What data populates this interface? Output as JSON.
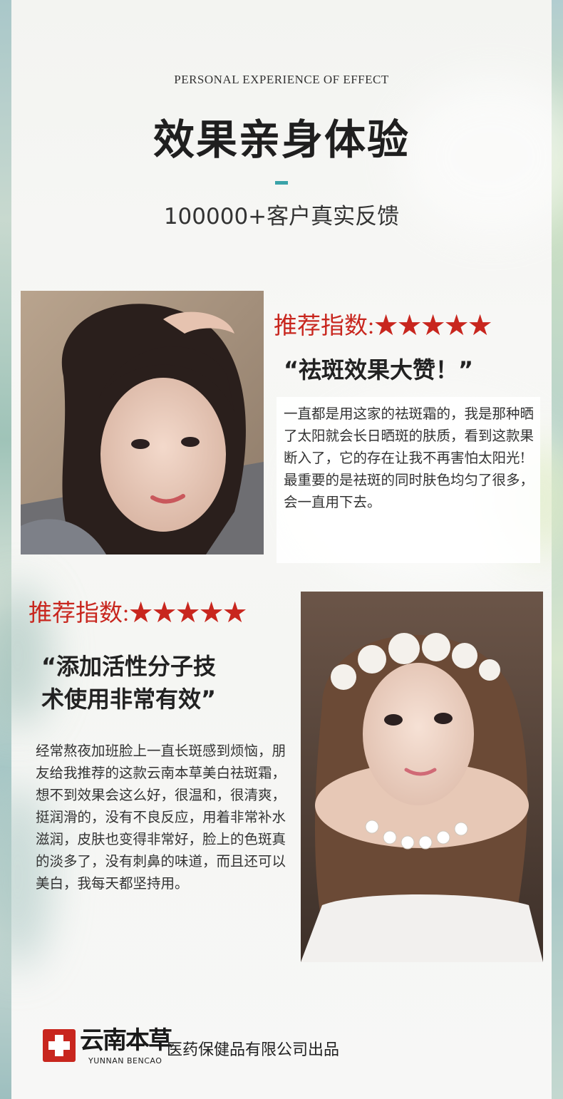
{
  "header": {
    "english_title": "PERSONAL EXPERIENCE OF EFFECT",
    "title": "效果亲身体验",
    "subtitle": "100000+客户真实反馈"
  },
  "testimonials": [
    {
      "rating_label": "推荐指数:",
      "stars": "★★★★★",
      "quote": "“祛斑效果大赞！”",
      "body": "一直都是用这家的祛斑霜的，我是那种晒了太阳就会长日晒斑的肤质，看到这款果断入了，它的存在让我不再害怕太阳光!最重要的是祛斑的同时肤色均匀了很多，会一直用下去。"
    },
    {
      "rating_label": "推荐指数:",
      "stars": "★★★★★",
      "quote": "“添加活性分子技\n  术使用非常有效”",
      "body": "经常熬夜加班脸上一直长斑感到烦恼，朋友给我推荐的这款云南本草美白祛斑霜，想不到效果会这么好，很温和，很清爽，挺润滑的，没有不良反应，用着非常补水滋润，皮肤也变得非常好，脸上的色斑真的淡多了，没有刺鼻的味道，而且还可以美白，我每天都坚持用。"
    }
  ],
  "footer": {
    "brand_cn": "云南本草",
    "brand_en": "YUNNAN BENCAO",
    "maker": "医药保健品有限公司出品"
  },
  "colors": {
    "accent_red": "#c8261e",
    "accent_teal": "#3aa3a9"
  },
  "icons": {
    "logo": "red-cross-logo",
    "star": "star-icon"
  }
}
